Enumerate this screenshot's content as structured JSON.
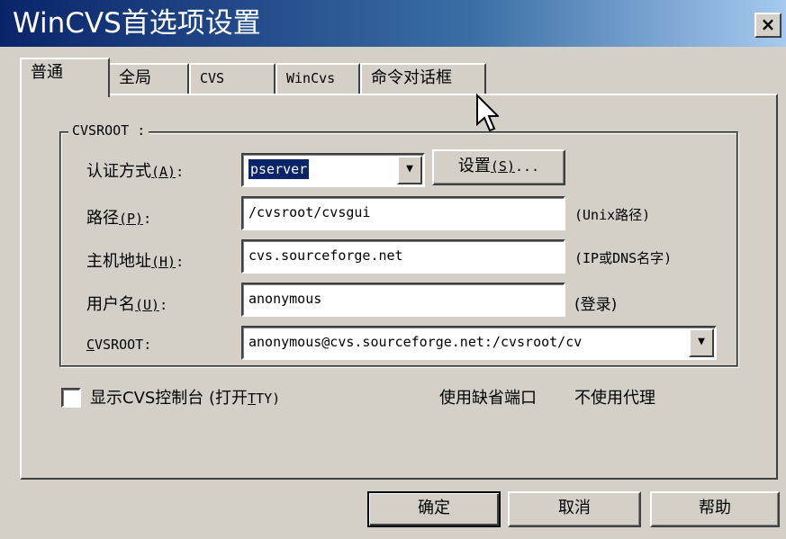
{
  "window": {
    "title": "WinCVS首选项设置",
    "close_label": "×"
  },
  "tabs": [
    {
      "label": "普通",
      "active": true
    },
    {
      "label": "全局"
    },
    {
      "label": "CVS"
    },
    {
      "label": "WinCvs"
    },
    {
      "label": "命令对话框"
    }
  ],
  "cvsroot_group": {
    "title": "CVSROOT :",
    "auth": {
      "label_pre": "认证方式",
      "label_acc": "(A)",
      "label_suffix": ":",
      "value": "pserver",
      "settings_button": {
        "pre": "设置",
        "acc": "(S)",
        "suffix": "..."
      }
    },
    "path": {
      "label_pre": "路径",
      "label_acc": "(P)",
      "label_suffix": ":",
      "value": "/cvsroot/cvsgui",
      "hint": "(Unix路径)"
    },
    "host": {
      "label_pre": "主机地址",
      "label_acc": "(H)",
      "label_suffix": ":",
      "value": "cvs.sourceforge.net",
      "hint": "(IP或DNS名字)"
    },
    "user": {
      "label_pre": "用户名",
      "label_acc": "(U)",
      "label_suffix": ":",
      "value": "anonymous",
      "hint": "(登录)"
    },
    "cvsroot": {
      "label_acc": "C",
      "label_rest": "VSROOT:",
      "value": "anonymous@cvs.sourceforge.net:/cvsroot/cv"
    }
  },
  "console_checkbox": {
    "checked": false,
    "label_pre": "显示CVS控制台 (打开",
    "label_acc": "T",
    "label_post": "TY)"
  },
  "static_texts": {
    "default_port": "使用缺省端口",
    "no_proxy": "不使用代理"
  },
  "buttons": {
    "ok": "确定",
    "cancel": "取消",
    "help": "帮助"
  },
  "icons": {
    "close": "close-icon",
    "dropdown": "chevron-down-icon",
    "cursor": "mouse-pointer-icon"
  }
}
